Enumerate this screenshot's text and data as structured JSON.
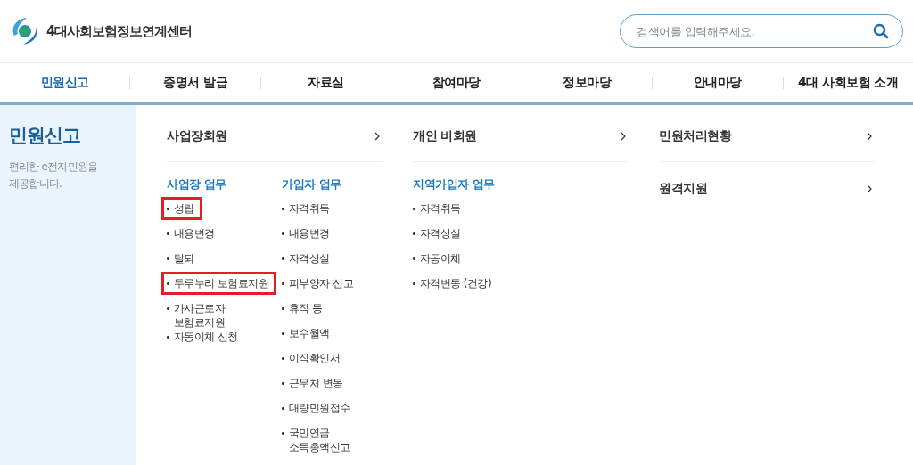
{
  "header": {
    "site_name": "4대사회보험정보연계센터",
    "search": {
      "placeholder": "검색어를 입력해주세요."
    }
  },
  "nav": [
    {
      "label": "민원신고",
      "selected": true
    },
    {
      "label": "증명서 발급",
      "selected": false
    },
    {
      "label": "자료실",
      "selected": false
    },
    {
      "label": "참여마당",
      "selected": false
    },
    {
      "label": "정보마당",
      "selected": false
    },
    {
      "label": "안내마당",
      "selected": false
    },
    {
      "label": "4대 사회보험 소개",
      "selected": false
    }
  ],
  "sidebar": {
    "title": "민원신고",
    "description": "편리한 e전자민원을\n제공합니다."
  },
  "menu_columns": [
    {
      "link": "사업장회원",
      "groups": [
        {
          "heading": "사업장 업무",
          "items": [
            {
              "label": "성립",
              "highlighted": true
            },
            {
              "label": "내용변경",
              "highlighted": false
            },
            {
              "label": "탈퇴",
              "highlighted": false
            },
            {
              "label": "두루누리 보험료지원",
              "highlighted": true
            },
            {
              "label": "가사근로자\n보험료지원",
              "highlighted": false
            },
            {
              "label": "자동이체 신청",
              "highlighted": false
            }
          ]
        },
        {
          "heading": "가입자 업무",
          "items": [
            {
              "label": "자격취득",
              "highlighted": false
            },
            {
              "label": "내용변경",
              "highlighted": false
            },
            {
              "label": "자격상실",
              "highlighted": false
            },
            {
              "label": "피부양자 신고",
              "highlighted": false
            },
            {
              "label": "휴직 등",
              "highlighted": false
            },
            {
              "label": "보수월액",
              "highlighted": false
            },
            {
              "label": "이직확인서",
              "highlighted": false
            },
            {
              "label": "근무처 변동",
              "highlighted": false
            },
            {
              "label": "대량민원접수",
              "highlighted": false
            },
            {
              "label": "국민연금\n소득총액신고",
              "highlighted": false
            }
          ]
        }
      ]
    },
    {
      "link": "개인 비회원",
      "groups": [
        {
          "heading": "지역가입자 업무",
          "items": [
            {
              "label": "자격취득",
              "highlighted": false
            },
            {
              "label": "자격상실",
              "highlighted": false
            },
            {
              "label": "자동이체",
              "highlighted": false
            },
            {
              "label": "자격변동 (건강)",
              "highlighted": false
            }
          ]
        }
      ]
    },
    {
      "links": [
        "민원처리현황",
        "원격지원"
      ]
    }
  ]
}
